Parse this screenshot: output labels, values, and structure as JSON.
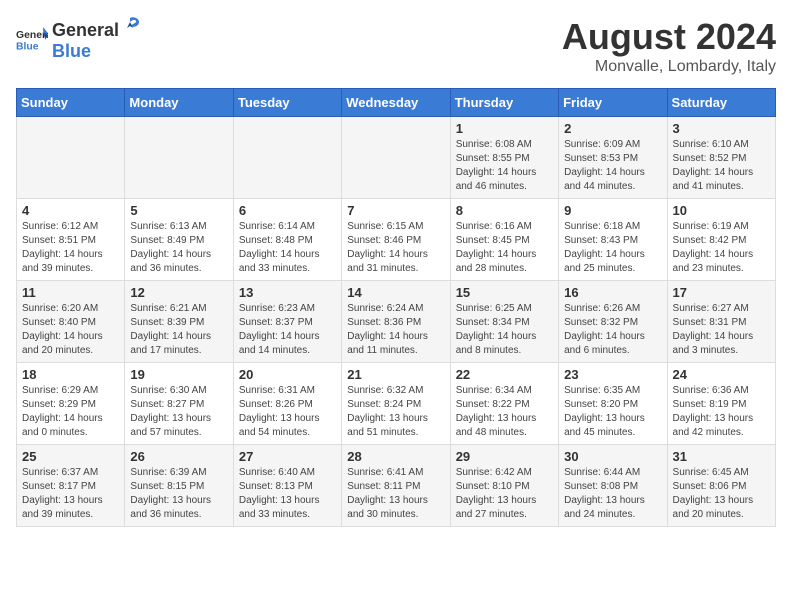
{
  "header": {
    "logo_general": "General",
    "logo_blue": "Blue",
    "main_title": "August 2024",
    "subtitle": "Monvalle, Lombardy, Italy"
  },
  "days_of_week": [
    "Sunday",
    "Monday",
    "Tuesday",
    "Wednesday",
    "Thursday",
    "Friday",
    "Saturday"
  ],
  "weeks": [
    [
      {
        "day": "",
        "info": ""
      },
      {
        "day": "",
        "info": ""
      },
      {
        "day": "",
        "info": ""
      },
      {
        "day": "",
        "info": ""
      },
      {
        "day": "1",
        "info": "Sunrise: 6:08 AM\nSunset: 8:55 PM\nDaylight: 14 hours and 46 minutes."
      },
      {
        "day": "2",
        "info": "Sunrise: 6:09 AM\nSunset: 8:53 PM\nDaylight: 14 hours and 44 minutes."
      },
      {
        "day": "3",
        "info": "Sunrise: 6:10 AM\nSunset: 8:52 PM\nDaylight: 14 hours and 41 minutes."
      }
    ],
    [
      {
        "day": "4",
        "info": "Sunrise: 6:12 AM\nSunset: 8:51 PM\nDaylight: 14 hours and 39 minutes."
      },
      {
        "day": "5",
        "info": "Sunrise: 6:13 AM\nSunset: 8:49 PM\nDaylight: 14 hours and 36 minutes."
      },
      {
        "day": "6",
        "info": "Sunrise: 6:14 AM\nSunset: 8:48 PM\nDaylight: 14 hours and 33 minutes."
      },
      {
        "day": "7",
        "info": "Sunrise: 6:15 AM\nSunset: 8:46 PM\nDaylight: 14 hours and 31 minutes."
      },
      {
        "day": "8",
        "info": "Sunrise: 6:16 AM\nSunset: 8:45 PM\nDaylight: 14 hours and 28 minutes."
      },
      {
        "day": "9",
        "info": "Sunrise: 6:18 AM\nSunset: 8:43 PM\nDaylight: 14 hours and 25 minutes."
      },
      {
        "day": "10",
        "info": "Sunrise: 6:19 AM\nSunset: 8:42 PM\nDaylight: 14 hours and 23 minutes."
      }
    ],
    [
      {
        "day": "11",
        "info": "Sunrise: 6:20 AM\nSunset: 8:40 PM\nDaylight: 14 hours and 20 minutes."
      },
      {
        "day": "12",
        "info": "Sunrise: 6:21 AM\nSunset: 8:39 PM\nDaylight: 14 hours and 17 minutes."
      },
      {
        "day": "13",
        "info": "Sunrise: 6:23 AM\nSunset: 8:37 PM\nDaylight: 14 hours and 14 minutes."
      },
      {
        "day": "14",
        "info": "Sunrise: 6:24 AM\nSunset: 8:36 PM\nDaylight: 14 hours and 11 minutes."
      },
      {
        "day": "15",
        "info": "Sunrise: 6:25 AM\nSunset: 8:34 PM\nDaylight: 14 hours and 8 minutes."
      },
      {
        "day": "16",
        "info": "Sunrise: 6:26 AM\nSunset: 8:32 PM\nDaylight: 14 hours and 6 minutes."
      },
      {
        "day": "17",
        "info": "Sunrise: 6:27 AM\nSunset: 8:31 PM\nDaylight: 14 hours and 3 minutes."
      }
    ],
    [
      {
        "day": "18",
        "info": "Sunrise: 6:29 AM\nSunset: 8:29 PM\nDaylight: 14 hours and 0 minutes."
      },
      {
        "day": "19",
        "info": "Sunrise: 6:30 AM\nSunset: 8:27 PM\nDaylight: 13 hours and 57 minutes."
      },
      {
        "day": "20",
        "info": "Sunrise: 6:31 AM\nSunset: 8:26 PM\nDaylight: 13 hours and 54 minutes."
      },
      {
        "day": "21",
        "info": "Sunrise: 6:32 AM\nSunset: 8:24 PM\nDaylight: 13 hours and 51 minutes."
      },
      {
        "day": "22",
        "info": "Sunrise: 6:34 AM\nSunset: 8:22 PM\nDaylight: 13 hours and 48 minutes."
      },
      {
        "day": "23",
        "info": "Sunrise: 6:35 AM\nSunset: 8:20 PM\nDaylight: 13 hours and 45 minutes."
      },
      {
        "day": "24",
        "info": "Sunrise: 6:36 AM\nSunset: 8:19 PM\nDaylight: 13 hours and 42 minutes."
      }
    ],
    [
      {
        "day": "25",
        "info": "Sunrise: 6:37 AM\nSunset: 8:17 PM\nDaylight: 13 hours and 39 minutes."
      },
      {
        "day": "26",
        "info": "Sunrise: 6:39 AM\nSunset: 8:15 PM\nDaylight: 13 hours and 36 minutes."
      },
      {
        "day": "27",
        "info": "Sunrise: 6:40 AM\nSunset: 8:13 PM\nDaylight: 13 hours and 33 minutes."
      },
      {
        "day": "28",
        "info": "Sunrise: 6:41 AM\nSunset: 8:11 PM\nDaylight: 13 hours and 30 minutes."
      },
      {
        "day": "29",
        "info": "Sunrise: 6:42 AM\nSunset: 8:10 PM\nDaylight: 13 hours and 27 minutes."
      },
      {
        "day": "30",
        "info": "Sunrise: 6:44 AM\nSunset: 8:08 PM\nDaylight: 13 hours and 24 minutes."
      },
      {
        "day": "31",
        "info": "Sunrise: 6:45 AM\nSunset: 8:06 PM\nDaylight: 13 hours and 20 minutes."
      }
    ]
  ]
}
